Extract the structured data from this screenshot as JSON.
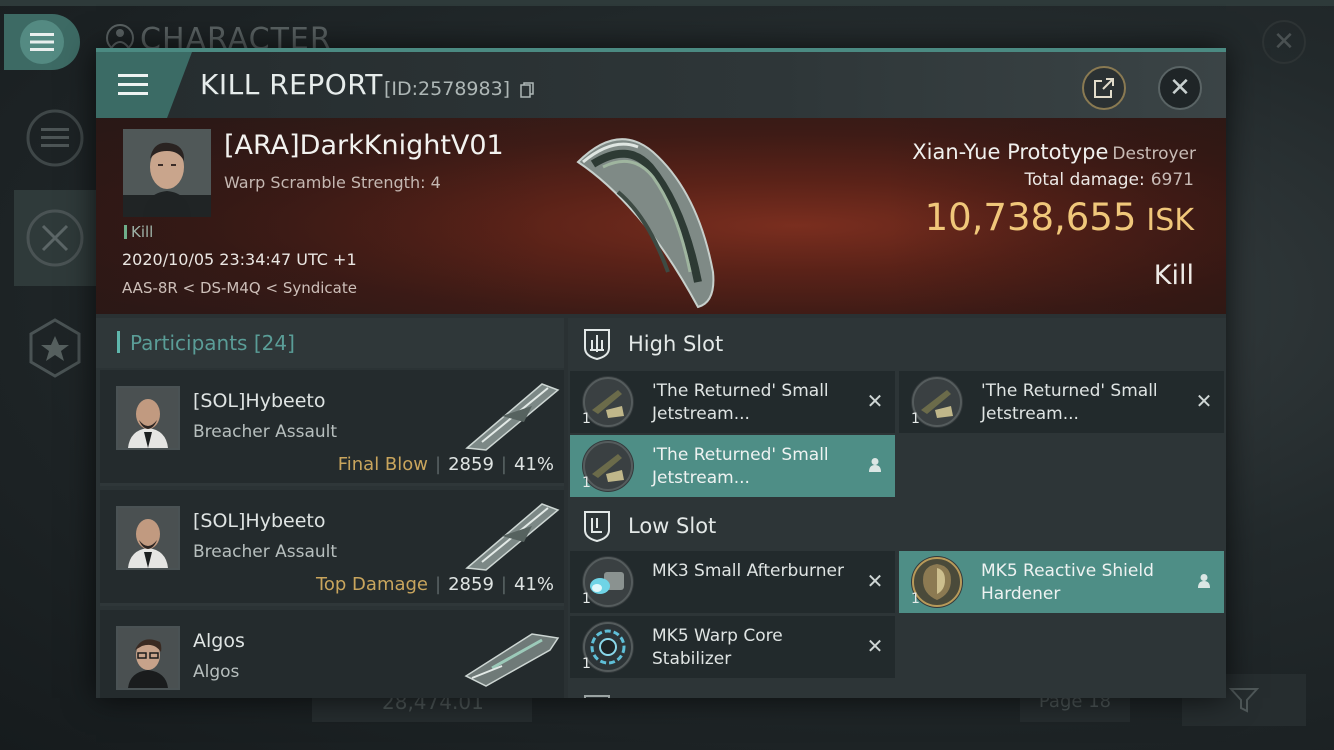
{
  "background": {
    "title": "CHARACTER",
    "search_value": "28,474.01",
    "page_label": "Page 18"
  },
  "header": {
    "title": "KILL REPORT",
    "id_label": "[ID:2578983]"
  },
  "victim": {
    "name": "[ARA]DarkKnightV01",
    "scramble": "Warp Scramble Strength: 4",
    "tag": "Kill",
    "timestamp": "2020/10/05 23:34:47 UTC +1",
    "location": "AAS-8R < DS-M4Q < Syndicate",
    "ship": "Xian-Yue Prototype",
    "ship_class": "Destroyer",
    "total_damage_label": "Total damage:",
    "total_damage": "6971",
    "isk_value": "10,738,655",
    "isk_unit": "ISK",
    "result": "Kill"
  },
  "participants": {
    "label": "Participants",
    "count": "[24]",
    "rows": [
      {
        "name": "[SOL]Hybeeto",
        "ship": "Breacher Assault",
        "role": "Final Blow",
        "damage": "2859",
        "percent": "41%"
      },
      {
        "name": "[SOL]Hybeeto",
        "ship": "Breacher Assault",
        "role": "Top Damage",
        "damage": "2859",
        "percent": "41%"
      },
      {
        "name": "Algos",
        "ship": "Algos",
        "role": "",
        "damage": "",
        "percent": ""
      }
    ]
  },
  "fitting": {
    "high_slot_label": "High Slot",
    "low_slot_label": "Low Slot",
    "high": [
      {
        "name": "'The Returned' Small Jetstream...",
        "count": "1",
        "status": "destroyed"
      },
      {
        "name": "'The Returned' Small Jetstream...",
        "count": "1",
        "status": "destroyed"
      },
      {
        "name": "'The Returned' Small Jetstream...",
        "count": "1",
        "status": "dropped"
      }
    ],
    "low": [
      {
        "name": "MK3 Small Afterburner",
        "count": "1",
        "status": "destroyed"
      },
      {
        "name": "MK5 Reactive Shield Hardener",
        "count": "1",
        "status": "dropped"
      },
      {
        "name": "MK5 Warp Core Stabilizer",
        "count": "1",
        "status": "destroyed"
      }
    ]
  },
  "colors": {
    "accent": "#4e8e86",
    "isk": "#f0c77a",
    "role": "#c9a55d"
  }
}
